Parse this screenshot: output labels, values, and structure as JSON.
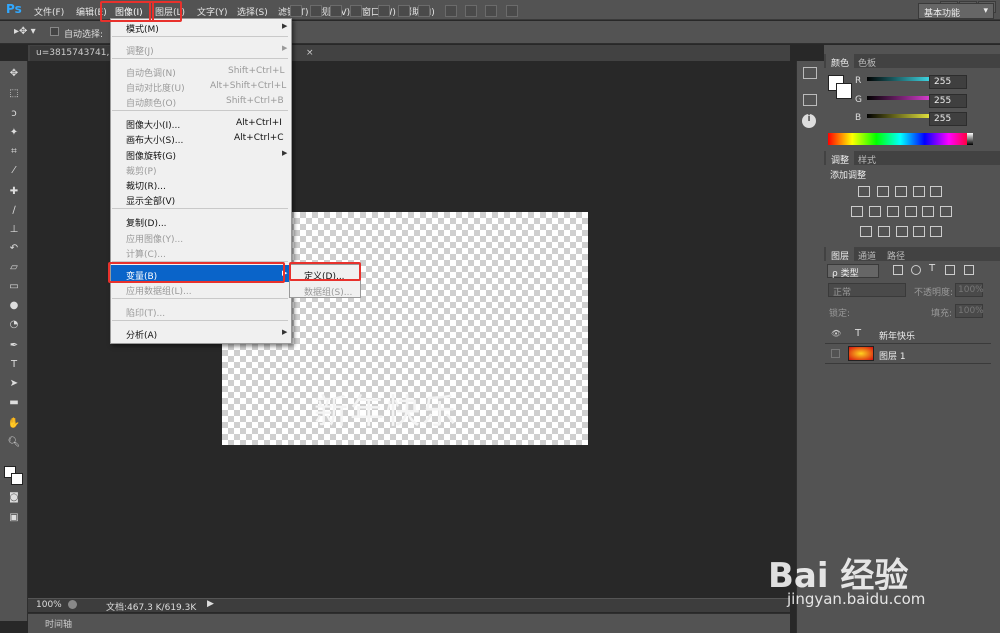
{
  "app": {
    "logo": "Ps"
  },
  "menubar": {
    "items": [
      "文件(F)",
      "编辑(E)",
      "图像(I)",
      "图层(L)",
      "文字(Y)",
      "选择(S)",
      "滤镜(T)",
      "视图(V)",
      "窗口(W)",
      "帮助(H)"
    ],
    "window_buttons": [
      "_",
      "□",
      "×"
    ]
  },
  "options": {
    "auto_select_label": "自动选择:",
    "workspace": "基本功能"
  },
  "document": {
    "tab_title": "u=3815743741,54",
    "tab_close": "×",
    "canvas_text": "新年快乐"
  },
  "status": {
    "zoom": "100%",
    "doc_info": "文档:467.3 K/619.3K",
    "timeline_label": "时间轴"
  },
  "image_menu": {
    "items": [
      {
        "label": "模式(M)",
        "shortcut": "",
        "submenu": true,
        "disabled": false
      },
      {
        "label": "调整(J)",
        "shortcut": "",
        "submenu": true,
        "disabled": true
      },
      {
        "label": "自动色调(N)",
        "shortcut": "Shift+Ctrl+L",
        "submenu": false,
        "disabled": true
      },
      {
        "label": "自动对比度(U)",
        "shortcut": "Alt+Shift+Ctrl+L",
        "submenu": false,
        "disabled": true
      },
      {
        "label": "自动颜色(O)",
        "shortcut": "Shift+Ctrl+B",
        "submenu": false,
        "disabled": true
      },
      {
        "label": "图像大小(I)...",
        "shortcut": "Alt+Ctrl+I",
        "submenu": false,
        "disabled": false
      },
      {
        "label": "画布大小(S)...",
        "shortcut": "Alt+Ctrl+C",
        "submenu": false,
        "disabled": false
      },
      {
        "label": "图像旋转(G)",
        "shortcut": "",
        "submenu": true,
        "disabled": false
      },
      {
        "label": "裁剪(P)",
        "shortcut": "",
        "submenu": false,
        "disabled": true
      },
      {
        "label": "裁切(R)...",
        "shortcut": "",
        "submenu": false,
        "disabled": false
      },
      {
        "label": "显示全部(V)",
        "shortcut": "",
        "submenu": false,
        "disabled": false
      },
      {
        "label": "复制(D)...",
        "shortcut": "",
        "submenu": false,
        "disabled": false
      },
      {
        "label": "应用图像(Y)...",
        "shortcut": "",
        "submenu": false,
        "disabled": true
      },
      {
        "label": "计算(C)...",
        "shortcut": "",
        "submenu": false,
        "disabled": true
      },
      {
        "label": "变量(B)",
        "shortcut": "",
        "submenu": true,
        "disabled": false
      },
      {
        "label": "应用数据组(L)...",
        "shortcut": "",
        "submenu": false,
        "disabled": true
      },
      {
        "label": "陷印(T)...",
        "shortcut": "",
        "submenu": false,
        "disabled": true
      },
      {
        "label": "分析(A)",
        "shortcut": "",
        "submenu": true,
        "disabled": false
      }
    ]
  },
  "variables_submenu": {
    "items": [
      {
        "label": "定义(D)...",
        "disabled": false
      },
      {
        "label": "数据组(S)...",
        "disabled": true
      }
    ]
  },
  "color_panel": {
    "tabs": [
      "颜色",
      "色板"
    ],
    "channels": [
      {
        "name": "R",
        "value": "255",
        "color": "#3fd9e6"
      },
      {
        "name": "G",
        "value": "255",
        "color": "#d93fd0"
      },
      {
        "name": "B",
        "value": "255",
        "color": "#e6e63f"
      }
    ]
  },
  "adjust_panel": {
    "tabs": [
      "调整",
      "样式"
    ],
    "title": "添加调整"
  },
  "layers_panel": {
    "tabs": [
      "图层",
      "通道",
      "路径"
    ],
    "filter": "ρ 类型",
    "blend_mode": "正常",
    "opacity_label": "不透明度:",
    "opacity_value": "100%",
    "lock_label": "锁定:",
    "fill_label": "填充:",
    "fill_value": "100%",
    "layers": [
      {
        "name": "新年快乐",
        "kind": "text",
        "visible": true
      },
      {
        "name": "图层 1",
        "kind": "image",
        "visible": false
      }
    ]
  },
  "watermark": {
    "logo": "Bai  经验",
    "url": "jingyan.baidu.com"
  }
}
